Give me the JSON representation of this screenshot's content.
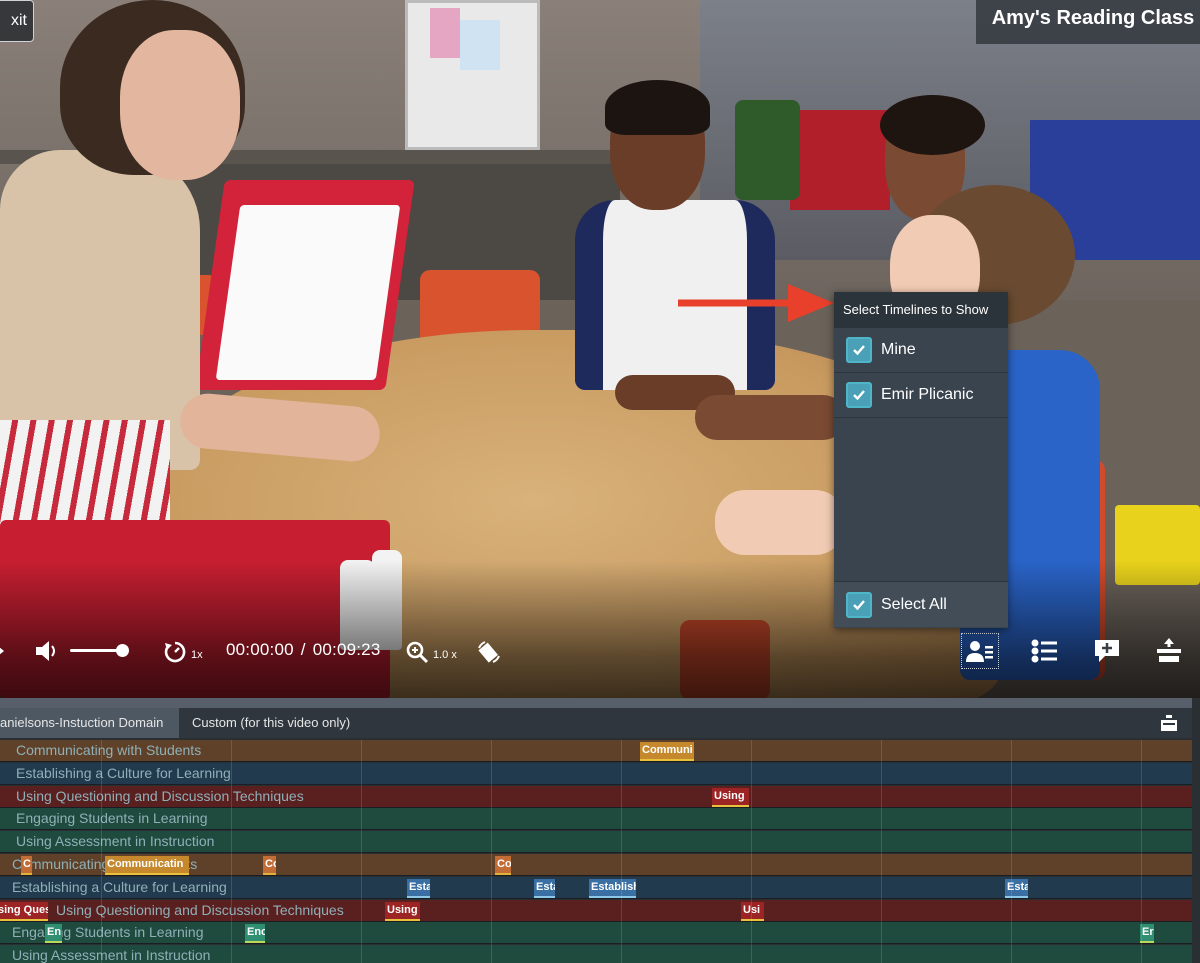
{
  "window": {
    "exit_label": "xit",
    "class_title": "Amy's Reading Class"
  },
  "controls": {
    "speed_label": "1x",
    "current_time": "00:00:00",
    "time_separator": "/",
    "total_time": "00:09:23",
    "zoom_label": "1.0 x",
    "volume_level": 0.85
  },
  "timelines_popup": {
    "title": "Select Timelines to Show",
    "options": [
      {
        "label": "Mine",
        "checked": true
      },
      {
        "label": "Emir Plicanic",
        "checked": true
      }
    ],
    "select_all_label": "Select All",
    "select_all_checked": true
  },
  "tabs": {
    "danielsons": "anielsons-Instuction Domain",
    "custom": "Custom (for this video only)"
  },
  "tracks": [
    {
      "label": "Communicating with Students",
      "color": "#5e4128",
      "markers": [
        {
          "text": "Communi",
          "style": "gold"
        }
      ]
    },
    {
      "label": "Establishing a Culture for Learning",
      "color": "#213a4d",
      "markers": []
    },
    {
      "label": "Using Questioning and Discussion Techniques",
      "color": "#5a1f1f",
      "markers": [
        {
          "text": "Using",
          "style": "red"
        }
      ]
    },
    {
      "label": "Engaging Students in Learning",
      "color": "#1f4a3e",
      "markers": []
    },
    {
      "label": "Using Assessment in Instruction",
      "color": "#1f4a3e",
      "markers": []
    },
    {
      "label": "Communicating with Students",
      "color": "#5e4128",
      "markers": [
        {
          "text": "C",
          "style": "brown"
        },
        {
          "text": "Communicatin",
          "style": "gold"
        },
        {
          "text": "Co",
          "style": "brown"
        },
        {
          "text": "Co",
          "style": "brown"
        }
      ]
    },
    {
      "label": "Establishing a Culture for Learning",
      "color": "#213a4d",
      "markers": [
        {
          "text": "Esta",
          "style": "blue"
        },
        {
          "text": "Esta",
          "style": "blue"
        },
        {
          "text": "Establish",
          "style": "blue"
        },
        {
          "text": "Esta",
          "style": "blue"
        }
      ]
    },
    {
      "label": "Using Questioning and Discussion Techniques",
      "color": "#5a1f1f",
      "markers": [
        {
          "text": "sing Ques",
          "style": "red"
        },
        {
          "text": "Using",
          "style": "red"
        },
        {
          "text": "Usi",
          "style": "red"
        }
      ]
    },
    {
      "label": "Engaging Students in Learning",
      "color": "#1f4a3e",
      "markers": [
        {
          "text": "En",
          "style": "green"
        },
        {
          "text": "Enc",
          "style": "green"
        },
        {
          "text": "Er",
          "style": "green"
        }
      ]
    },
    {
      "label": "Using Assessment in Instruction",
      "color": "#1f4a3e",
      "markers": []
    }
  ],
  "colors": {
    "accent": "#4aa0b6",
    "arrow": "#e8402a"
  },
  "icons": {
    "play": "play-icon",
    "volume": "volume-icon",
    "speed": "replay-speed-icon",
    "zoom": "zoom-in-icon",
    "rotate": "rotate-icon",
    "timelines": "user-list-icon",
    "list": "list-icon",
    "comment": "comment-add-icon",
    "split": "split-icon",
    "collapse": "collapse-icon",
    "check": "check-icon"
  }
}
